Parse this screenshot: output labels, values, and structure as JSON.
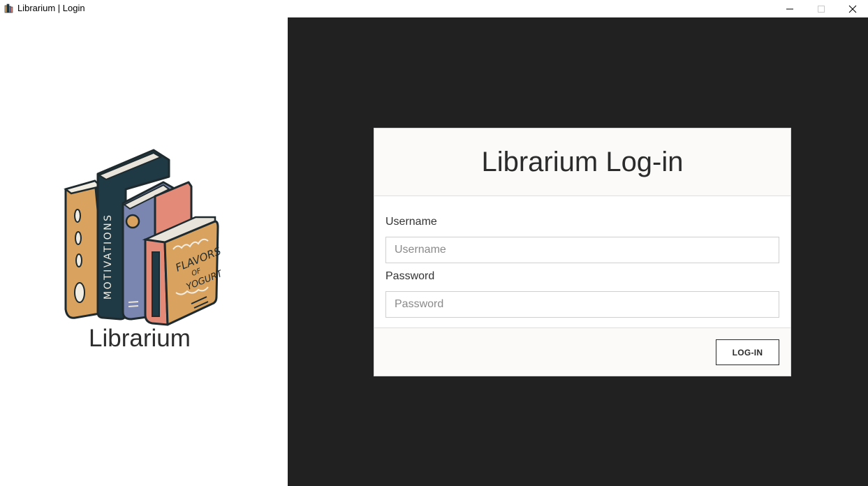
{
  "window": {
    "title": "Librarium | Login",
    "app_icon": "books-icon",
    "controls": [
      "minimize-icon",
      "maximize-icon",
      "close-icon"
    ]
  },
  "brand": {
    "name": "Librarium",
    "book_spine_text": "MOTIVATIONS",
    "book_cover_text": [
      "FLAVORS",
      "OF",
      "YOGURT"
    ],
    "colors": {
      "teal": "#1f3a44",
      "tan": "#d9a35f",
      "slate": "#7a86b0",
      "salmon": "#e38a79",
      "outline": "#1e2a2e"
    }
  },
  "login": {
    "title": "Librarium Log-in",
    "username_label": "Username",
    "username_placeholder": "Username",
    "username_value": "",
    "password_label": "Password",
    "password_placeholder": "Password",
    "password_value": "",
    "submit_label": "LOG-IN"
  },
  "theme": {
    "background_dark": "#212121",
    "card_header_bg": "#fbfaf8"
  }
}
